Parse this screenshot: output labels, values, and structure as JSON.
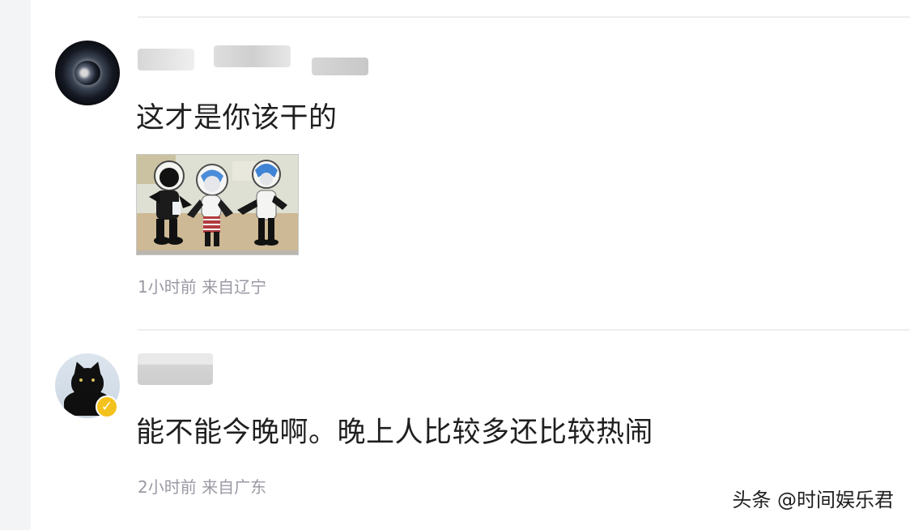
{
  "comments": [
    {
      "text": "这才是你该干的",
      "meta": "1小时前 来自辽宁"
    },
    {
      "text": "能不能今晚啊。晚上人比较多还比较热闹",
      "meta": "2小时前 来自广东"
    }
  ],
  "watermark": "头条 @时间娱乐君"
}
